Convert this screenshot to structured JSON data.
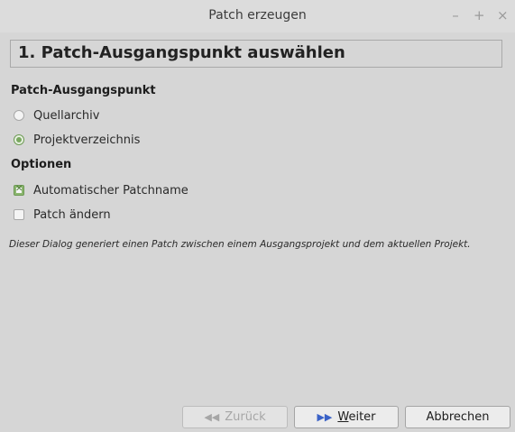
{
  "window": {
    "title": "Patch erzeugen",
    "controls": [
      "–",
      "+",
      "×"
    ]
  },
  "page": {
    "header": "1. Patch-Ausgangspunkt auswählen"
  },
  "source_section": {
    "heading": "Patch-Ausgangspunkt",
    "options": [
      {
        "label": "Quellarchiv",
        "selected": false
      },
      {
        "label": "Projektverzeichnis",
        "selected": true
      }
    ]
  },
  "options_section": {
    "heading": "Optionen",
    "items": [
      {
        "label": "Automatischer Patchname",
        "checked": true
      },
      {
        "label": "Patch ändern",
        "checked": false
      }
    ]
  },
  "description": "Dieser Dialog generiert einen Patch zwischen einem Ausgangsprojekt und dem aktuellen Projekt.",
  "buttons": {
    "back": {
      "label": "Zurück",
      "icon": "double-left-arrow-icon",
      "enabled": false
    },
    "next": {
      "label_pre": "",
      "label_underline": "W",
      "label_post": "eiter",
      "icon": "double-right-arrow-icon",
      "enabled": true
    },
    "cancel": {
      "label": "Abbrechen",
      "enabled": true
    }
  },
  "colors": {
    "accent_green": "#7aa861",
    "next_icon_blue": "#3a62c7",
    "background": "#d6d6d6"
  }
}
